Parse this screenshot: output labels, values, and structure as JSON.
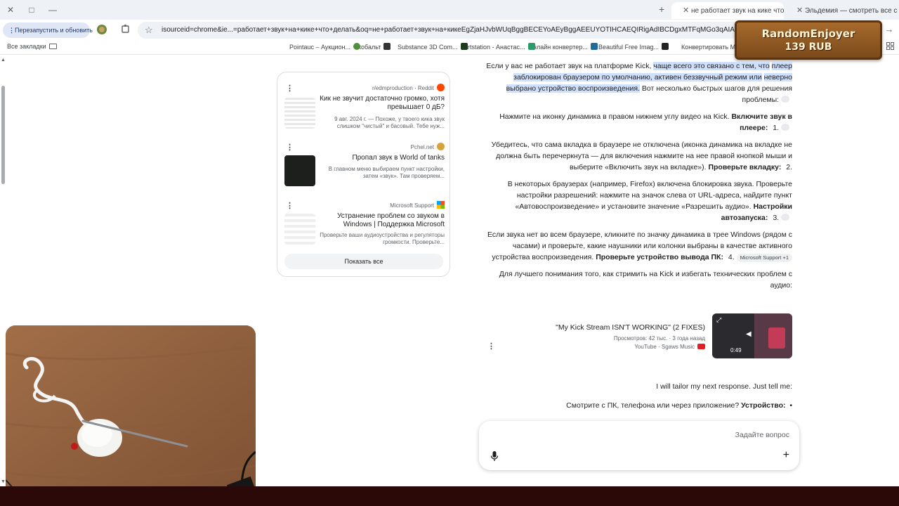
{
  "window": {
    "controls": [
      "✕",
      "□",
      "—"
    ]
  },
  "tabs": [
    {
      "label": "Эльдемия — смотреть все се",
      "active": false
    },
    {
      "label": "не работает звук на кике что",
      "active": true
    }
  ],
  "toolbar": {
    "relaunch_label": "Перезапустить и обновить",
    "url": "isourceid=chrome&ie...=работает+звук+на+кике+что+делать&oq=не+работает+звук+на+кикеEgZjaHJvbWUqBggBECEYoAEyBggAEEUYOTIHCAEQIRigAdIBCDgxMTFqMGo3qAIAsAIA&sourceid=chrome&ie..."
  },
  "bookmarks": {
    "all_label": "Все закладки",
    "items": [
      "Конвертировать M...",
      "Beautiful Free Imag...",
      "Онлайн конвертер...",
      "Artstation - Анастас...",
      "Substance 3D Com...",
      "кобальт",
      "Pointauc – Аукцион..."
    ]
  },
  "overlay": {
    "name": "RandomEnjoyer",
    "amount": "139 RUB"
  },
  "sources": {
    "items": [
      {
        "site": "Reddit",
        "sub": "r/edmproduction",
        "title": "Кик не звучит достаточно громко, хотя превышает 0 дБ?",
        "snippet": "9 авг. 2024 г. — Похоже, у твоего кика звук слишком \"чистый\" и басовый. Тебе нуж..."
      },
      {
        "site": "Pchel.net",
        "title": "Пропал звук в World of tanks",
        "snippet": "В главном меню выбираем пункт настройки, затем «звук». Там проверяем..."
      },
      {
        "site": "Microsoft Support",
        "title": "Устранение проблем со звуком в Windows | Поддержка Microsoft",
        "snippet": "Проверьте ваши аудиоустройства и регуляторы громкости. Проверьте..."
      }
    ],
    "show_all": "Показать все"
  },
  "answer": {
    "intro_plain": "Если у вас не работает звук на платформе Kick,",
    "intro_highlight_1": "чаще всего это связано с тем, что",
    "intro_highlight_2": "плеер заблокирован браузером по умолчанию, активен беззвучный режим или",
    "intro_highlight_3": "неверно выбрано устройство воспроизведения.",
    "intro_end": "Вот несколько быстрых шагов для решения проблемы:",
    "steps": [
      {
        "num": "1.",
        "bold": "Включите звук в плеере:",
        "text": "Нажмите на иконку динамика в правом нижнем углу видео на Kick."
      },
      {
        "num": "2.",
        "bold": "Проверьте вкладку:",
        "text": "Убедитесь, что сама вкладка в браузере не отключена (иконка динамика на вкладке не должна быть перечеркнута — для включения нажмите на нее правой кнопкой мыши и выберите «Включить звук на вкладке»)."
      },
      {
        "num": "3.",
        "bold": "Настройки автозапуска:",
        "text": "В некоторых браузерах (например, Firefox) включена блокировка звука. Проверьте настройки разрешений: нажмите на значок слева от URL-адреса, найдите пункт «Автовоспроизведение» и установите значение «Разрешить аудио»."
      },
      {
        "num": "4.",
        "bold": "Проверьте устройство вывода ПК:",
        "text": "Если звука нет во всем браузере, кликните по значку динамика в трее Windows (рядом с часами) и проверьте, какие наушники или колонки выбраны в качестве активного устройства воспроизведения.",
        "chip": "Microsoft Support +1"
      }
    ],
    "outro": "Для лучшего понимания того, как стримить на Kick и избегать технических проблем с аудио:"
  },
  "video": {
    "title": "\"My Kick Stream ISN'T WORKING\" (2 FIXES)",
    "stats": "Просмотров: 42 тыс. · 3 года назад",
    "source": "YouTube · Sgaws Music",
    "duration": "0:49"
  },
  "followup": {
    "text": "I will tailor my next response. Just tell me:",
    "bullet_bold": "Устройство:",
    "bullet_text": "Смотрите с ПК, телефона или через приложение?"
  },
  "ask": {
    "placeholder": "Задайте вопрос"
  },
  "colors": {
    "highlight": "#cfe0fc",
    "chrome_bg": "#eef1f6",
    "badge": "#8b5722"
  }
}
